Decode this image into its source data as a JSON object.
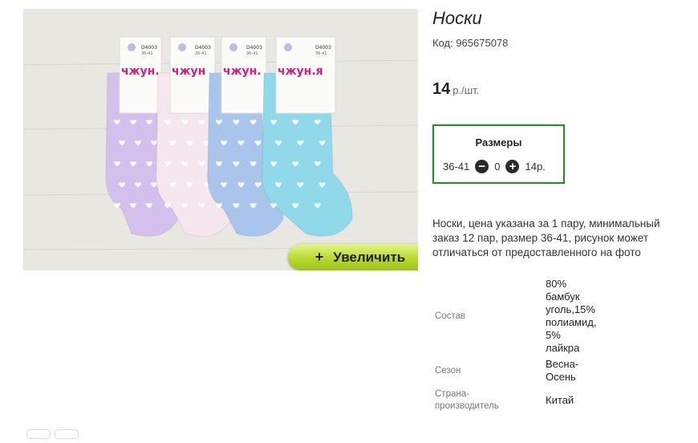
{
  "product": {
    "title": "Носки",
    "code": "Код: 965675078",
    "price": {
      "value": "14",
      "unit": "р./шт."
    }
  },
  "image": {
    "zoom_label": "Увеличить",
    "zoom_icon": "+",
    "socks": [
      {
        "label_brand": "чжун.",
        "label_code": "D4003",
        "label_size": "36-41",
        "color": "#d4c0ec"
      },
      {
        "label_brand": "чжун",
        "label_code": "D4003",
        "label_size": "36-41",
        "color": "#f6e6ee"
      },
      {
        "label_brand": "чжун.",
        "label_code": "D4003",
        "label_size": "36-41",
        "color": "#aac5ec"
      },
      {
        "label_brand": "чжун.я",
        "label_code": "D4003",
        "label_size": "36-41",
        "color": "#8fd9ea"
      }
    ],
    "brand_color": "#e0187f"
  },
  "sizes": {
    "title": "Размеры",
    "rows": [
      {
        "size": "36-41",
        "qty": "0",
        "price": "14р.",
        "minus_icon": "minus-circle-icon",
        "plus_icon": "plus-circle-icon"
      }
    ]
  },
  "description": "Носки, цена указана за 1 пару, минимальный заказ 12 пар, размер 36-41, рисунок может отличаться от предоставленного на фото",
  "properties": [
    {
      "key": "Состав",
      "value": [
        "80%",
        "бамбук",
        "уголь,15%",
        "полиамид,",
        "5%",
        "лайкра"
      ]
    },
    {
      "key": "Сезон",
      "value": [
        "Весна-",
        "Осень"
      ]
    },
    {
      "key": [
        "Страна-",
        "производитель"
      ],
      "value": [
        "Китай"
      ]
    }
  ]
}
